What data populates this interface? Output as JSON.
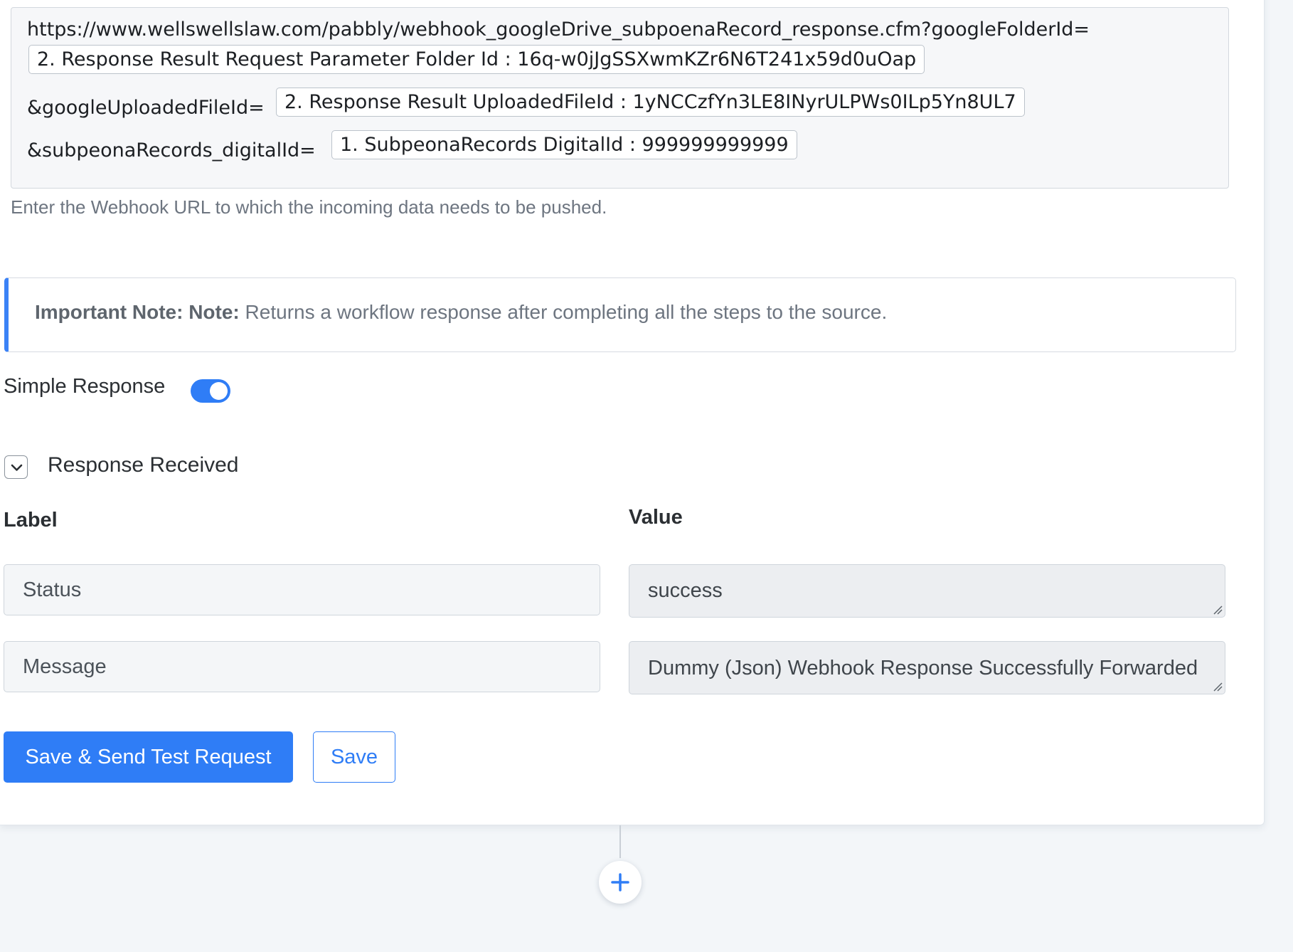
{
  "top_red_fragment": ", ",
  "webhook": {
    "base_url": "https://www.wellswellslaw.com/pabbly/webhook_googleDrive_subpoenaRecord_response.cfm?googleFolderId=",
    "folder_pill": "2. Response Result Request Parameter Folder Id : 16q-w0jJgSSXwmKZr6N6T241x59d0uOap",
    "param2_label": "&googleUploadedFileId=",
    "file_pill": "2. Response Result UploadedFileId : 1yNCCzfYn3LE8INyrULPWs0ILp5Yn8UL7",
    "param3_label": "&subpeonaRecords_digitalId=",
    "digital_pill": "1. SubpeonaRecords DigitalId : 999999999999",
    "help_text": "Enter the Webhook URL to which the incoming data needs to be pushed."
  },
  "note": {
    "prefix": "Important Note: Note:",
    "text": " Returns a workflow response after completing all the steps to the source."
  },
  "simple_response": {
    "label": "Simple Response",
    "enabled": true
  },
  "response_received": {
    "label": "Response Received",
    "expanded": true
  },
  "table": {
    "label_header": "Label",
    "value_header": "Value",
    "rows": [
      {
        "label": "Status",
        "value": "success"
      },
      {
        "label": "Message",
        "value": "Dummy (Json) Webhook Response Successfully Forwarded"
      }
    ]
  },
  "buttons": {
    "save_send": "Save & Send Test Request",
    "save": "Save"
  },
  "colors": {
    "accent": "#2f7df6",
    "note_border": "#3b82f6",
    "error_red": "#e53935"
  },
  "icons": {
    "collapse": "chevron-down-icon",
    "add_step": "plus-icon"
  }
}
